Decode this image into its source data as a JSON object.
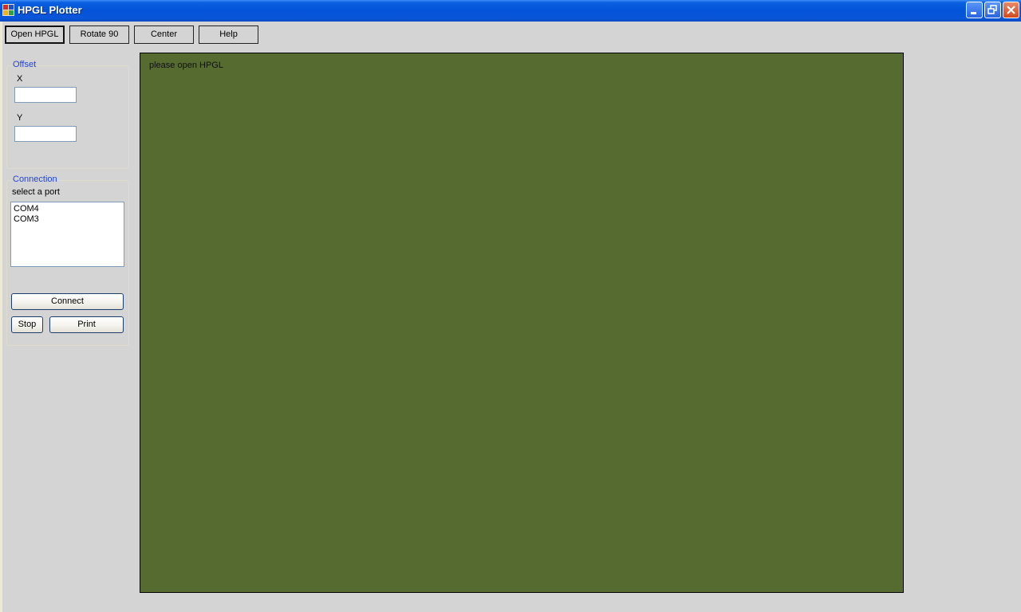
{
  "window": {
    "title": "HPGL Plotter",
    "controls": [
      "minimize",
      "restore",
      "close"
    ]
  },
  "toolbar": {
    "open_label": "Open HPGL",
    "rotate_label": "Rotate 90",
    "center_label": "Center",
    "help_label": "Help"
  },
  "offset": {
    "title": "Offset",
    "x_label": "X",
    "x_value": "",
    "y_label": "Y",
    "y_value": ""
  },
  "connection": {
    "title": "Connection",
    "prompt": "select a port",
    "ports": [
      "COM4",
      "COM3"
    ],
    "connect_label": "Connect",
    "stop_label": "Stop",
    "print_label": "Print"
  },
  "canvas": {
    "message": "please open HPGL",
    "background": "#566b30"
  }
}
